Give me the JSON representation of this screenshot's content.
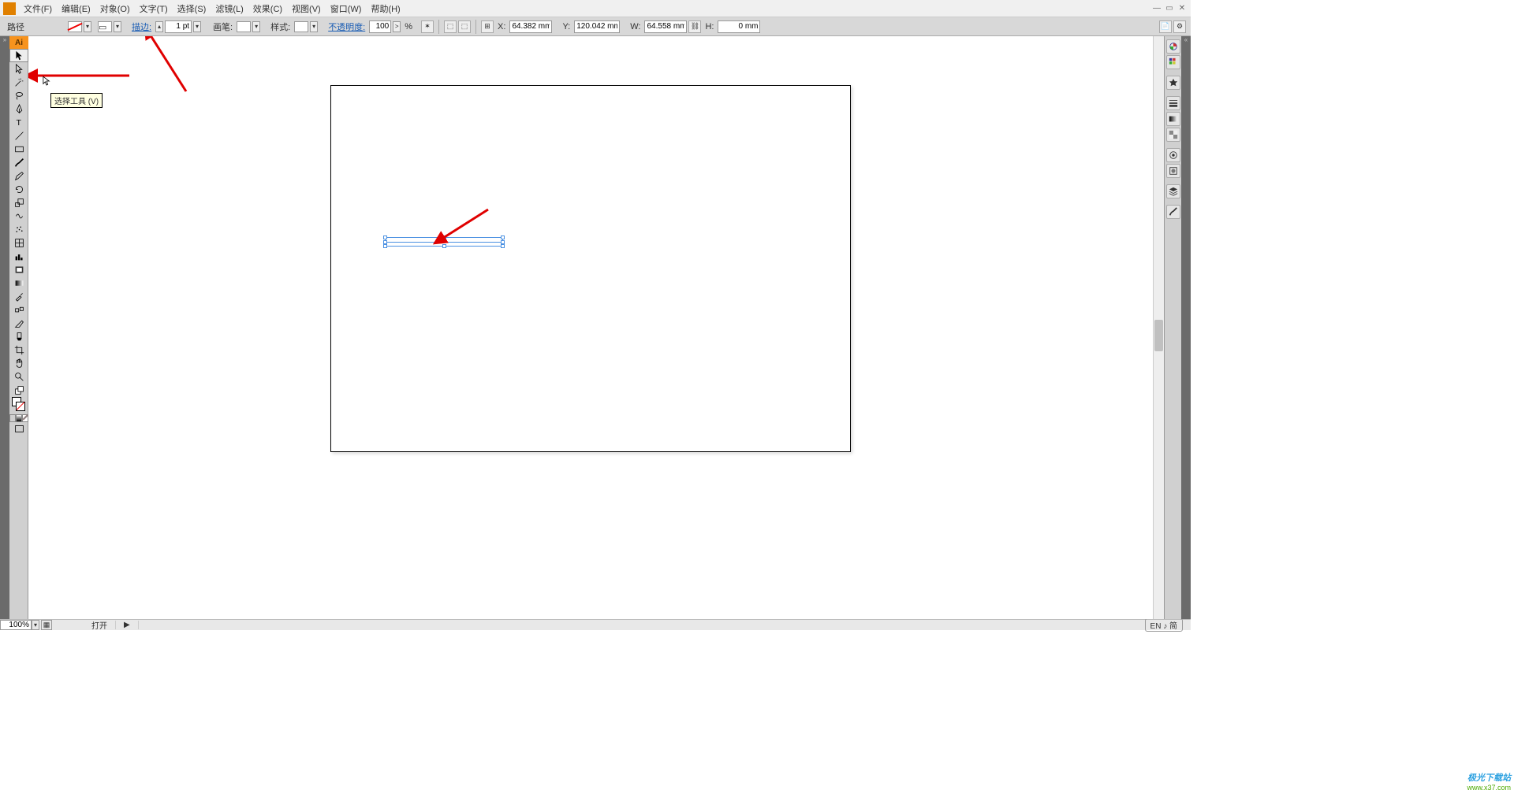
{
  "menu": {
    "items": [
      "文件(F)",
      "编辑(E)",
      "对象(O)",
      "文字(T)",
      "选择(S)",
      "滤镜(L)",
      "效果(C)",
      "视图(V)",
      "窗口(W)",
      "帮助(H)"
    ]
  },
  "optbar": {
    "path_label": "路径",
    "stroke_label": "描边:",
    "stroke_value": "1 pt",
    "brush_label": "画笔:",
    "style_label": "样式:",
    "opacity_label": "不透明度:",
    "opacity_value": "100",
    "opacity_unit_arrow": ">",
    "opacity_unit": "%",
    "x_label": "X:",
    "x_value": "64.382 mm",
    "y_label": "Y:",
    "y_value": "120.042 mm",
    "w_label": "W:",
    "w_value": "64.558 mm",
    "h_label": "H:",
    "h_value": "0 mm"
  },
  "tools": {
    "ai_logo": "Ai",
    "tooltip": "选择工具 (V)",
    "list": [
      "selection",
      "direct",
      "wand",
      "lasso",
      "pen",
      "type",
      "line",
      "rect",
      "brush",
      "pencil",
      "rotate",
      "scale",
      "warp",
      "symbol",
      "mesh",
      "graph",
      "artboard",
      "gradient",
      "eyedropper",
      "blend",
      "slice",
      "live-paint",
      "select-behind",
      "hand",
      "zoom",
      "fill-toggle"
    ]
  },
  "right_panels": [
    "color",
    "swatches",
    "type",
    "stroke",
    "appearance",
    "layers",
    "gradient",
    "transparency",
    "align",
    "pathfinder",
    "transform",
    "links",
    "brushes"
  ],
  "status": {
    "zoom": "100%",
    "open_mode": "打开",
    "lang_badge": "EN ♪ 简"
  },
  "watermark": {
    "line1": "极光下载站",
    "line2": "www.x37.com"
  }
}
